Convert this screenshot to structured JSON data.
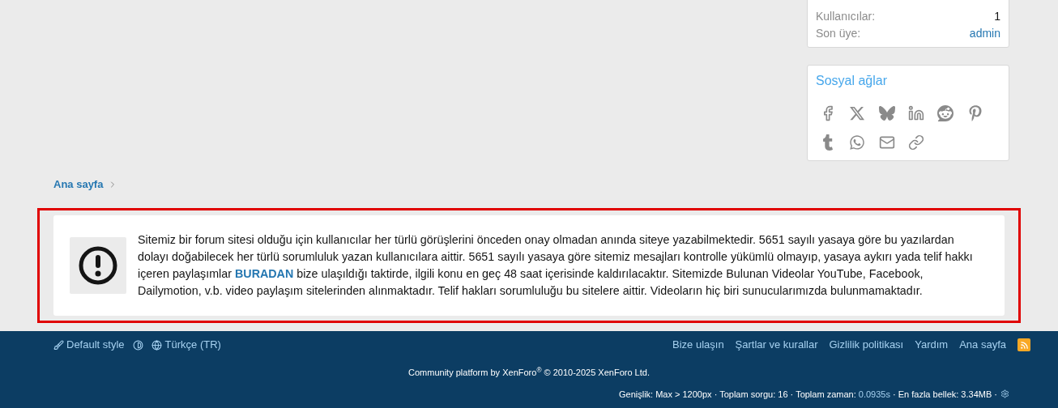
{
  "stats": [
    {
      "label": "Kullanıcılar:",
      "value": "1",
      "kind": "plain"
    },
    {
      "label": "Son üye:",
      "value": "admin",
      "kind": "link"
    }
  ],
  "social": {
    "title": "Sosyal ağlar",
    "share_buttons": [
      {
        "kind": "facebook"
      },
      {
        "kind": "x"
      },
      {
        "kind": "bluesky"
      },
      {
        "kind": "linkedin"
      },
      {
        "kind": "reddit"
      },
      {
        "kind": "pinterest"
      },
      {
        "kind": "tumblr"
      },
      {
        "kind": "whatsapp"
      },
      {
        "kind": "email"
      },
      {
        "kind": "link"
      }
    ]
  },
  "breadcrumb": [
    {
      "label": "Ana sayfa"
    }
  ],
  "notice": {
    "text": "Sitemiz bir forum sitesi olduğu için kullanıcılar her türlü görüşlerini önceden onay olmadan anında siteye yazabilmektedir. 5651 sayılı yasaya göre bu yazılardan dolayı doğabilecek her türlü sorumluluk yazan kullanıcılara aittir. 5651 sayılı yasaya göre sitemiz mesajları kontrolle yükümlü olmayıp, yasaya aykırı yada telif hakkı içeren paylaşımlar **BURADAN** bize ulaşıldığı taktirde, ilgili konu en geç 48 saat içerisinde kaldırılacaktır. Sitemizde Bulunan Videolar YouTube, Facebook, Dailymotion, v.b. video paylaşım sitelerinden alınmaktadır. Telif hakları sorumluluğu bu sitelere aittir. Videoların hiç biri sunucularımızda bulunmamaktadır."
  },
  "footer": {
    "style": "Default style",
    "language": "Türkçe (TR)",
    "links": [
      "Bize ulaşın",
      "Şartlar ve kurallar",
      "Gizlilik politikası",
      "Yardım",
      "Ana sayfa"
    ],
    "copyright": "Community platform by XenForo$^{®}$ © 2010-2025 XenForo Ltd.",
    "debug": [
      {
        "text": "Genişlik: Max > 1200px · Toplam sorgu: 16 · Toplam zaman: ",
        "kind": "plain"
      },
      {
        "text": "0.0935s",
        "kind": "link"
      },
      {
        "text": " · En fazla bellek: 3.34MB ·",
        "kind": "plain"
      }
    ]
  }
}
